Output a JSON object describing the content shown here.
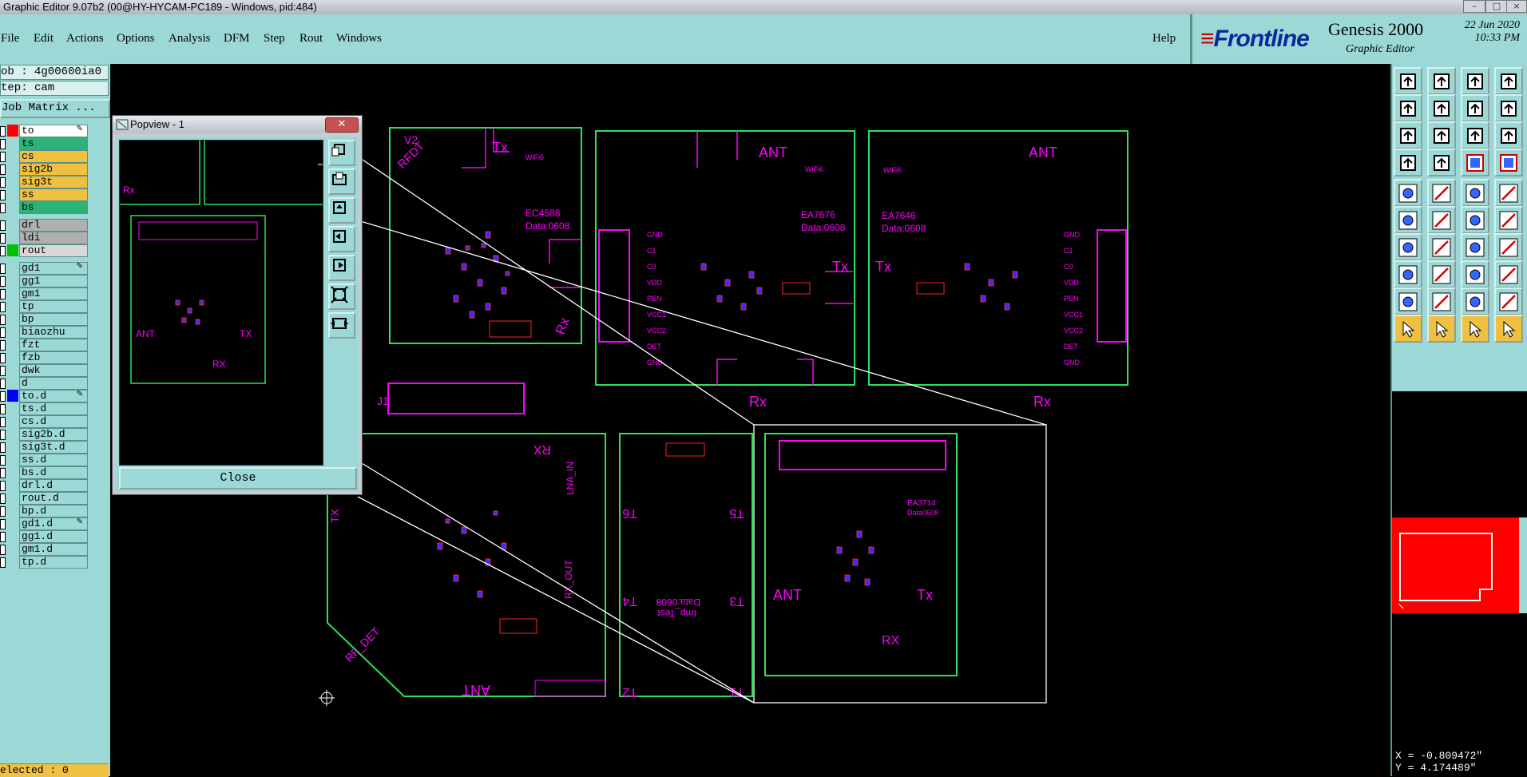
{
  "window": {
    "title": "Graphic Editor 9.07b2 (00@HY-HYCAM-PC189 - Windows, pid:484)"
  },
  "menu": {
    "items": [
      "File",
      "Edit",
      "Actions",
      "Options",
      "Analysis",
      "DFM",
      "Step",
      "Rout",
      "Windows"
    ],
    "help": "Help"
  },
  "brand": {
    "logo": "Frontline",
    "product": "Genesis 2000",
    "subtitle": "Graphic Editor",
    "date": "22 Jun 2020",
    "time": "10:33 PM"
  },
  "job": {
    "job_label": "ob : 4g00600ia0",
    "step_label": "tep: cam",
    "matrix_button": "Job Matrix ..."
  },
  "layers": [
    {
      "name": "to",
      "color": "#ff0000",
      "fill": "#ffffff",
      "pen": true
    },
    {
      "name": "ts",
      "color": "",
      "fill": "#2db37a",
      "pen": false
    },
    {
      "name": "cs",
      "color": "",
      "fill": "#f0c040",
      "pen": false
    },
    {
      "name": "sig2b",
      "color": "",
      "fill": "#f0c040",
      "pen": false
    },
    {
      "name": "sig3t",
      "color": "",
      "fill": "#f0c040",
      "pen": false
    },
    {
      "name": "ss",
      "color": "",
      "fill": "#f0c040",
      "pen": false
    },
    {
      "name": "bs",
      "color": "",
      "fill": "#2db37a",
      "pen": false
    },
    {
      "name": "drl",
      "color": "",
      "fill": "#b0b0b0",
      "pen": false
    },
    {
      "name": "ldi",
      "color": "",
      "fill": "#b0b0b0",
      "pen": false
    },
    {
      "name": "rout",
      "color": "#00c000",
      "fill": "#d8d8d8",
      "pen": false
    },
    {
      "name": "gd1",
      "color": "",
      "fill": "#9cd9d6",
      "pen": true
    },
    {
      "name": "gg1",
      "color": "",
      "fill": "#9cd9d6",
      "pen": false
    },
    {
      "name": "gm1",
      "color": "",
      "fill": "#9cd9d6",
      "pen": false
    },
    {
      "name": "tp",
      "color": "",
      "fill": "#9cd9d6",
      "pen": false
    },
    {
      "name": "bp",
      "color": "",
      "fill": "#9cd9d6",
      "pen": false
    },
    {
      "name": "biaozhu",
      "color": "",
      "fill": "#9cd9d6",
      "pen": false
    },
    {
      "name": "fzt",
      "color": "",
      "fill": "#9cd9d6",
      "pen": false
    },
    {
      "name": "fzb",
      "color": "",
      "fill": "#9cd9d6",
      "pen": false
    },
    {
      "name": "dwk",
      "color": "",
      "fill": "#9cd9d6",
      "pen": false
    },
    {
      "name": "d",
      "color": "",
      "fill": "#9cd9d6",
      "pen": false
    },
    {
      "name": "to.d",
      "color": "#0000ff",
      "fill": "#9cd9d6",
      "pen": true
    },
    {
      "name": "ts.d",
      "color": "",
      "fill": "#9cd9d6",
      "pen": false
    },
    {
      "name": "cs.d",
      "color": "",
      "fill": "#9cd9d6",
      "pen": false
    },
    {
      "name": "sig2b.d",
      "color": "",
      "fill": "#9cd9d6",
      "pen": false
    },
    {
      "name": "sig3t.d",
      "color": "",
      "fill": "#9cd9d6",
      "pen": false
    },
    {
      "name": "ss.d",
      "color": "",
      "fill": "#9cd9d6",
      "pen": false
    },
    {
      "name": "bs.d",
      "color": "",
      "fill": "#9cd9d6",
      "pen": false
    },
    {
      "name": "drl.d",
      "color": "",
      "fill": "#9cd9d6",
      "pen": false
    },
    {
      "name": "rout.d",
      "color": "",
      "fill": "#9cd9d6",
      "pen": false
    },
    {
      "name": "bp.d",
      "color": "",
      "fill": "#9cd9d6",
      "pen": false
    },
    {
      "name": "gd1.d",
      "color": "",
      "fill": "#9cd9d6",
      "pen": true
    },
    {
      "name": "gg1.d",
      "color": "",
      "fill": "#9cd9d6",
      "pen": false
    },
    {
      "name": "gm1.d",
      "color": "",
      "fill": "#9cd9d6",
      "pen": false
    },
    {
      "name": "tp.d",
      "color": "",
      "fill": "#9cd9d6",
      "pen": false
    }
  ],
  "status": {
    "selected": "elected : 0"
  },
  "popview": {
    "title": "Popview - 1",
    "close": "Close"
  },
  "board": {
    "labels": {
      "v2": "V2",
      "rfdt": "RFDT",
      "tx": "Tx",
      "rx": "Rx",
      "ant": "ANT",
      "wifi": "WiFi6",
      "ec4588": "EC4588",
      "data0608": "Data:0608",
      "ea7676": "EA7676",
      "ea7646": "EA7646",
      "j1": "J1",
      "rx_upper": "RX",
      "lna_in": "LNA_IN",
      "rx_out": "RX_OUT",
      "rf_det": "RF_DET",
      "tx_upper": "TX",
      "t1": "T1",
      "t2": "T2",
      "t3": "T3",
      "t4": "T4",
      "t5": "T5",
      "t6": "T6",
      "imp_test": "Imp_Test",
      "imp_data": "Data:0608",
      "ea3714": "EA3714",
      "ea3714_data": "Data0608",
      "gnd": "GND",
      "c1": "C1",
      "c0": "C0",
      "vdd": "VDD",
      "pen": "PEN",
      "vcc1": "VCC1",
      "vcc2": "VCC2",
      "det": "DET"
    }
  },
  "coords": {
    "x": "X = -0.809472\"",
    "y": "Y = 4.174489\""
  },
  "colors": {
    "panel": "#9cd9d6",
    "profile": "#2ee05a",
    "silk": "#ff00ff",
    "copper": "#ff2020",
    "pad": "#3030ff"
  }
}
